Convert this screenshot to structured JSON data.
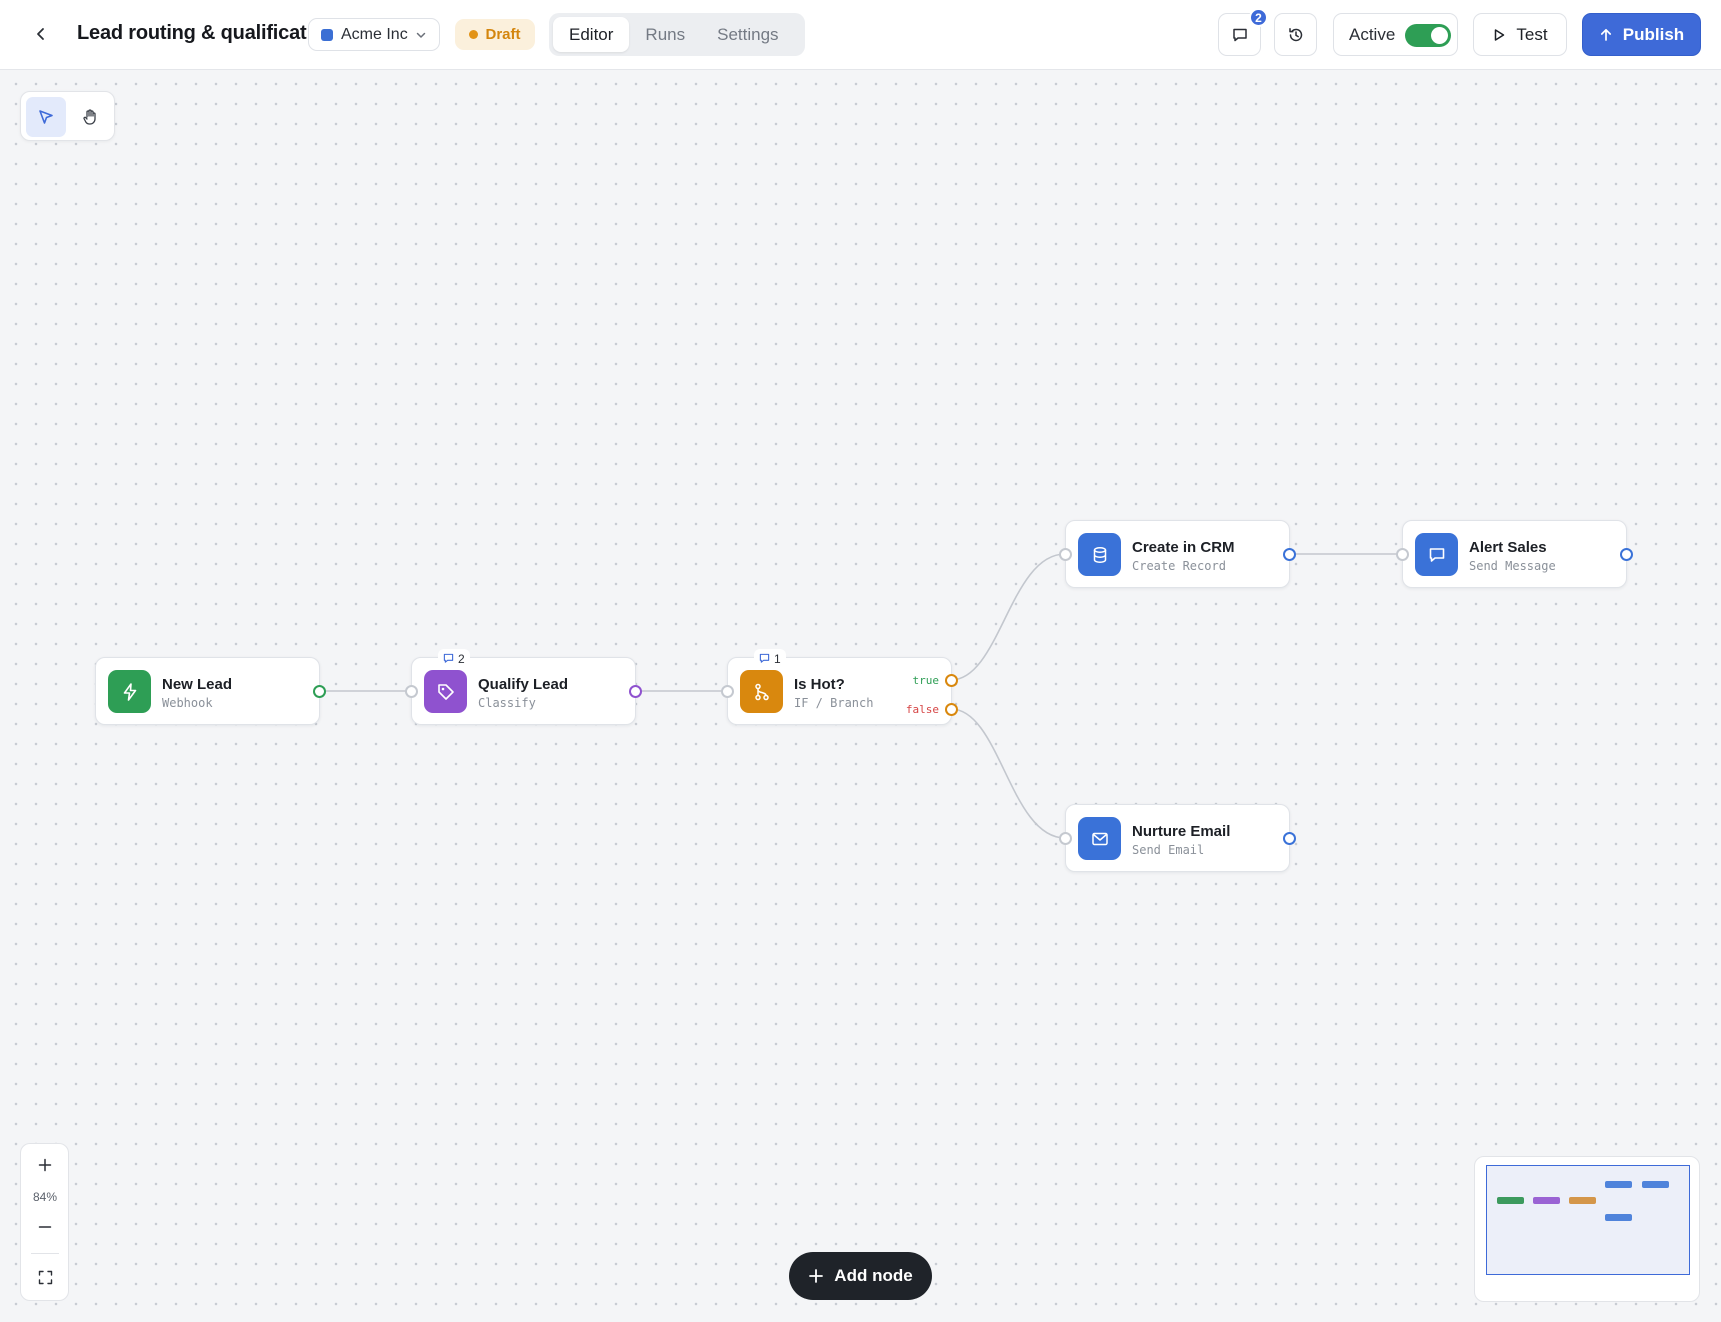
{
  "header": {
    "workflow_title": "Lead routing & qualificat",
    "workspace": {
      "name": "Acme Inc",
      "color": "#3b6fd4"
    },
    "status_badge": "Draft",
    "tabs": [
      {
        "label": "Editor",
        "active": true
      },
      {
        "label": "Runs",
        "active": false
      },
      {
        "label": "Settings",
        "active": false
      }
    ],
    "comments_count": "2",
    "active_label": "Active",
    "active_enabled": true,
    "test_label": "Test",
    "publish_label": "Publish"
  },
  "canvas": {
    "tools": [
      {
        "name": "select",
        "icon": "pointer-icon",
        "active": true
      },
      {
        "name": "pan",
        "icon": "hand-icon",
        "active": false
      }
    ],
    "nodes": [
      {
        "id": "new-lead",
        "title": "New Lead",
        "subtitle": "Webhook",
        "color": "#2e9e55",
        "icon": "lightning-icon"
      },
      {
        "id": "qualify-lead",
        "title": "Qualify Lead",
        "subtitle": "Classify",
        "color": "#8f52cf",
        "icon": "tag-icon",
        "comments": "2"
      },
      {
        "id": "is-hot",
        "title": "Is Hot?",
        "subtitle": "IF / Branch",
        "color": "#d9880e",
        "icon": "branch-icon",
        "comments": "1",
        "branches": [
          "true",
          "false"
        ]
      },
      {
        "id": "create-crm",
        "title": "Create in CRM",
        "subtitle": "Create Record",
        "color": "#3a72d8",
        "icon": "database-icon"
      },
      {
        "id": "alert-sales",
        "title": "Alert Sales",
        "subtitle": "Send Message",
        "color": "#3a72d8",
        "icon": "message-icon"
      },
      {
        "id": "nurture-email",
        "title": "Nurture Email",
        "subtitle": "Send Email",
        "color": "#3a72d8",
        "icon": "mail-icon"
      }
    ],
    "branch_colors": {
      "true": "#2e9e55",
      "false": "#d64545"
    },
    "zoom_level": "84%",
    "add_node_label": "Add node"
  }
}
